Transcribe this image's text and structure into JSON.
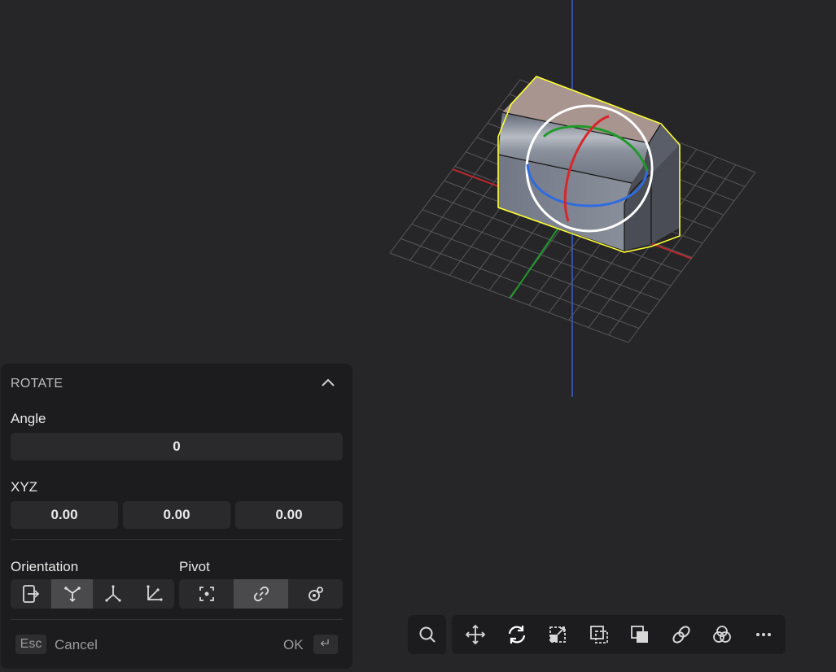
{
  "panel": {
    "title": "ROTATE",
    "angle_label": "Angle",
    "angle_value": "0",
    "xyz_label": "XYZ",
    "x_value": "0.00",
    "y_value": "0.00",
    "z_value": "0.00",
    "orientation_label": "Orientation",
    "pivot_label": "Pivot",
    "orientation_options": [
      "world-icon",
      "normal-icon",
      "local-icon",
      "view-icon"
    ],
    "orientation_selected": "normal-icon",
    "pivot_options": [
      "center-icon",
      "link-icon",
      "custom-pivot-icon"
    ],
    "pivot_selected": "link-icon",
    "esc_key": "Esc",
    "cancel_label": "Cancel",
    "ok_label": "OK",
    "enter_key": "↵"
  },
  "toolbar": {
    "search_icon": "search-icon",
    "tools": [
      "move-icon",
      "rotate-icon",
      "scale-icon",
      "select-box-icon",
      "copy-icon",
      "link-icon",
      "boolean-icon",
      "more-icon"
    ],
    "active_tool": "rotate-icon"
  },
  "colors": {
    "background": "#262628",
    "panel": "#1c1c1e",
    "selection": "#ffff33",
    "axis_x": "#c0262b",
    "axis_y": "#1f9a2a",
    "axis_z": "#3a5fd0",
    "gizmo_ring": "#ffffff"
  }
}
